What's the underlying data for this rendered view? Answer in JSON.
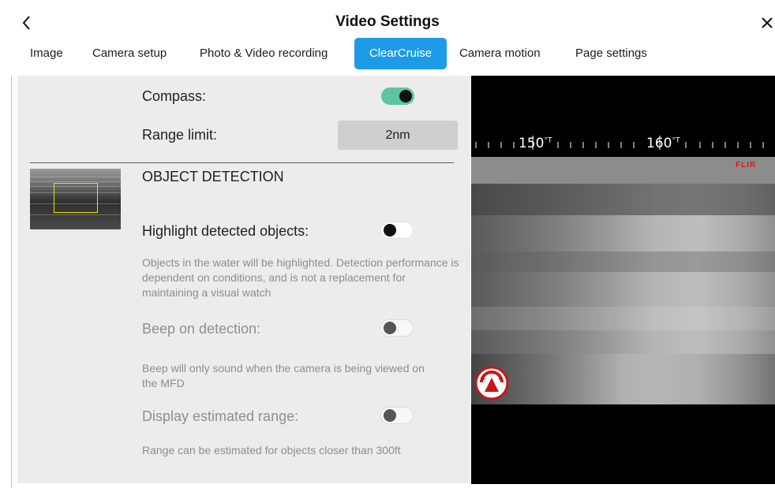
{
  "header": {
    "title": "Video Settings",
    "back_icon": "chevron-left-icon",
    "close_icon": "close-icon"
  },
  "tabs": [
    {
      "label": "Image",
      "active": false
    },
    {
      "label": "Camera setup",
      "active": false
    },
    {
      "label": "Photo & Video recording",
      "active": false
    },
    {
      "label": "ClearCruise",
      "active": true
    },
    {
      "label": "Camera motion",
      "active": false
    },
    {
      "label": "Page settings",
      "active": false
    }
  ],
  "settings": {
    "compass": {
      "label": "Compass:",
      "enabled": true
    },
    "range_limit": {
      "label": "Range limit:",
      "value": "2nm"
    },
    "object_detection": {
      "title": "OBJECT DETECTION",
      "highlight": {
        "label": "Highlight detected objects:",
        "enabled": false,
        "description": "Objects in the water will be highlighted.  Detection performance is dependent on conditions, and is not a replacement for maintaining a visual watch"
      },
      "beep": {
        "label": "Beep on detection:",
        "enabled": false,
        "description": "Beep will only sound when the camera is being viewed on the MFD"
      },
      "estimated_range": {
        "label": "Display estimated range:",
        "enabled": false,
        "description": "Range can be estimated for objects closer than 300ft"
      }
    }
  },
  "camera_view": {
    "headings": [
      {
        "value": "150",
        "unit": "°T"
      },
      {
        "value": "160",
        "unit": "°T"
      }
    ],
    "brand_tag": "FLIR",
    "icon": "camera-pan-icon"
  },
  "colors": {
    "accent": "#1d9be6",
    "toggle_on": "#5ec4a2",
    "panel_bg": "#ececec",
    "brand_red": "#d01c1c"
  }
}
